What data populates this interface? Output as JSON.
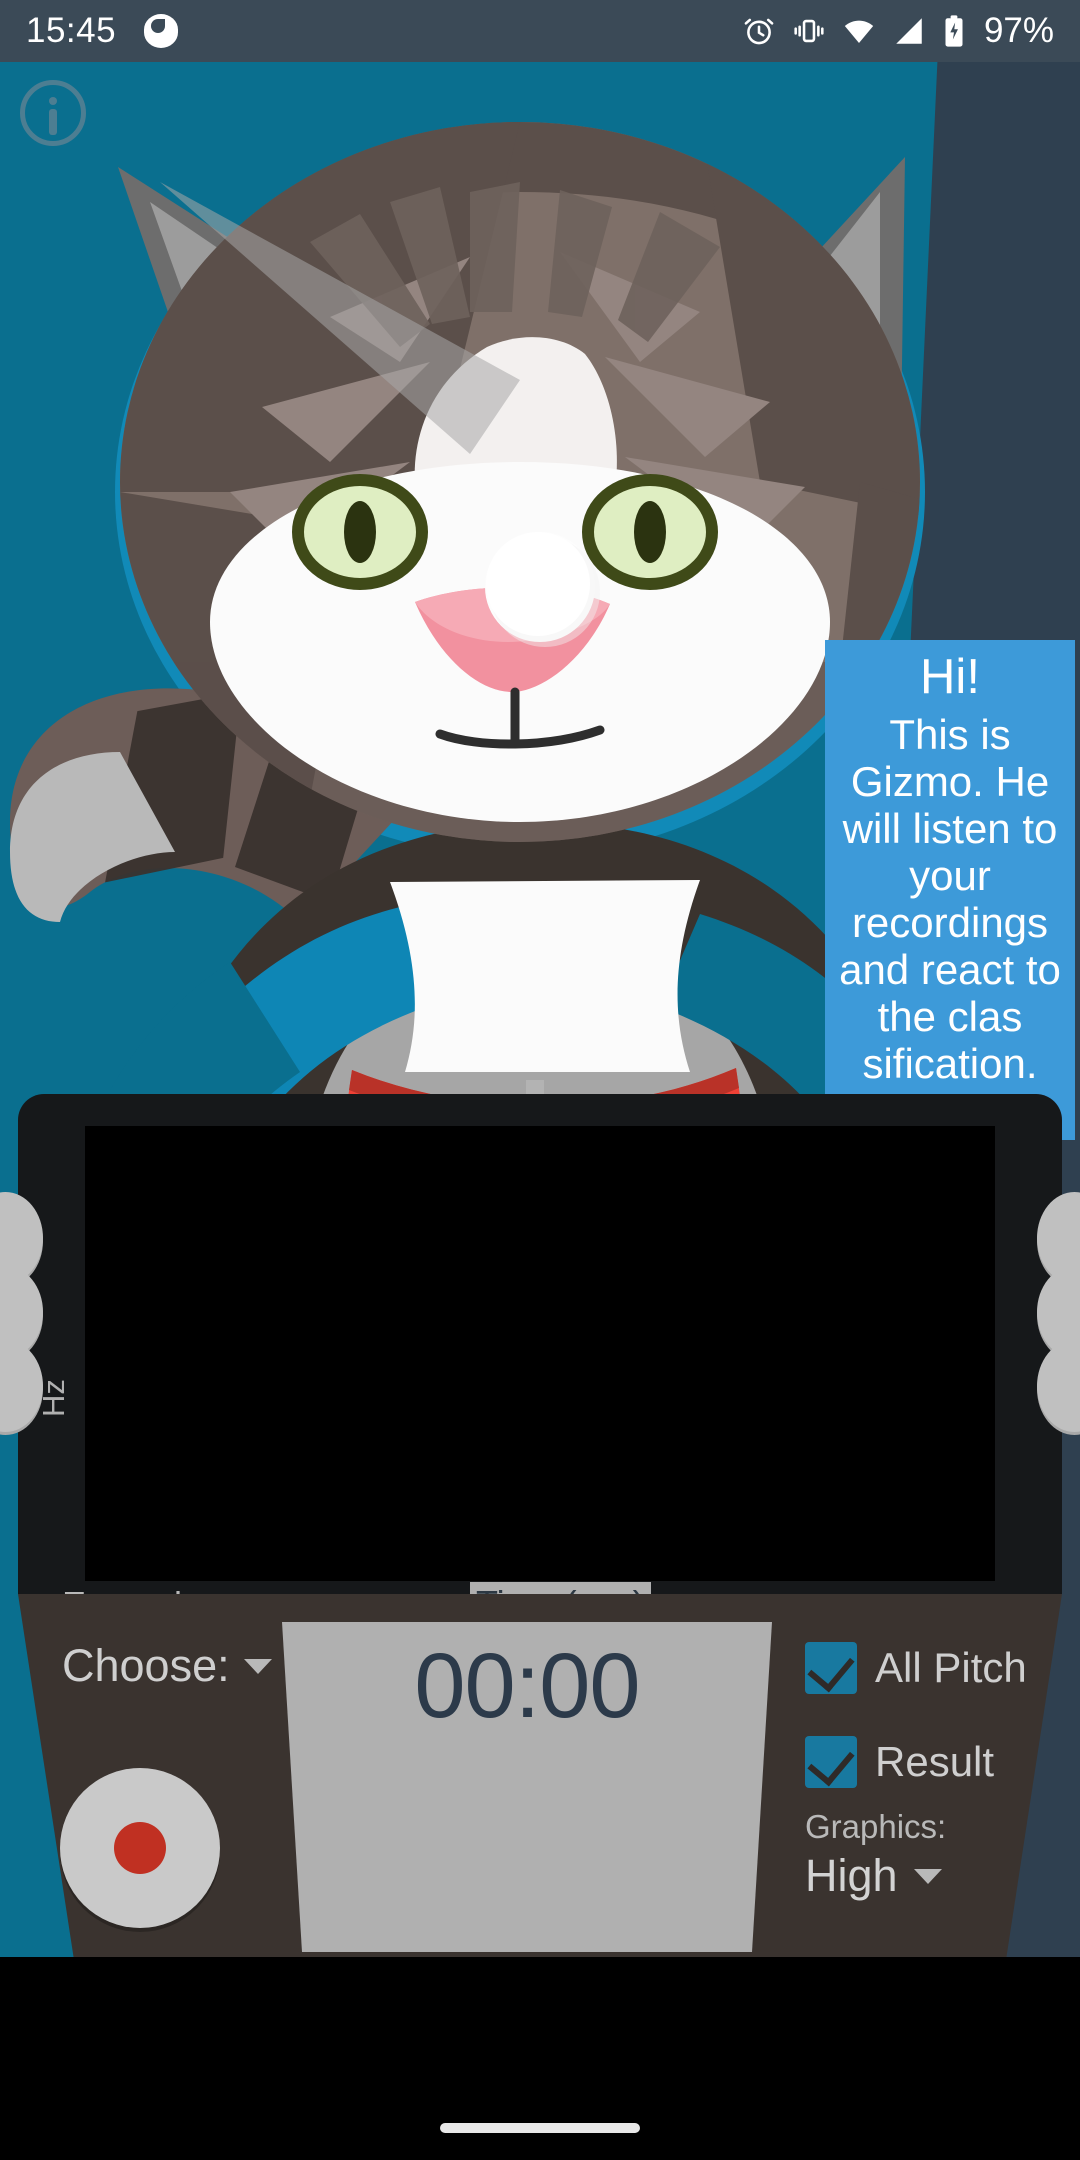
{
  "statusbar": {
    "time": "15:45",
    "battery_percent": "97%",
    "icons": [
      "app-notification-icon",
      "alarm-icon",
      "vibrate-icon",
      "wifi-icon",
      "cellular-signal-icon",
      "battery-charging-icon"
    ]
  },
  "app": {
    "background_color": "#0a6f8f",
    "info_button": "info-icon",
    "mascot": {
      "name": "Gizmo",
      "description": "grey-and-white tabby cat holding a tablet, wearing a red collar"
    },
    "bubble": {
      "greeting": "Hi!",
      "body": "This is Gizmo. He will listen to your recordings and react to the clas sification.",
      "background_color": "#3d9ad9"
    }
  },
  "device": {
    "y_axis_label": "Hz",
    "x_axis_label": "Time (sec)",
    "examples_label": "Examples:",
    "screen_color": "#000000"
  },
  "controls": {
    "choose_label": "Choose:",
    "timer": "00:00",
    "record_button": "record-icon",
    "checkboxes": [
      {
        "label": "All Pitch",
        "checked": true
      },
      {
        "label": "Result",
        "checked": true
      }
    ],
    "graphics_label": "Graphics:",
    "graphics_value": "High",
    "accent_color": "#1879a0"
  }
}
